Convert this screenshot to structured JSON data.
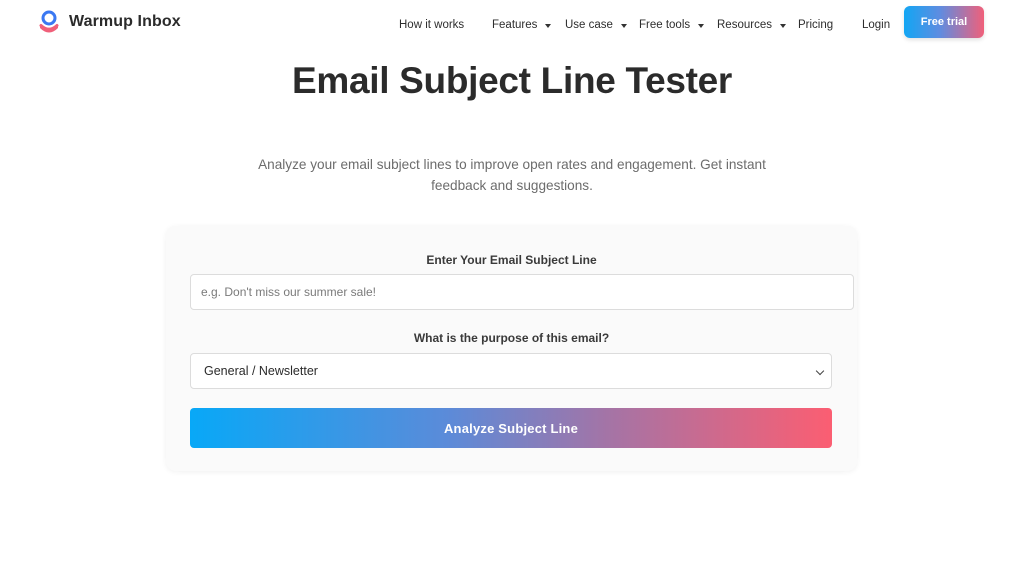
{
  "brand": {
    "name": "Warmup Inbox",
    "logo_icon": "warmup-inbox-logo-icon",
    "colors": {
      "ring": "#3a78f2",
      "base": "#f0607a"
    }
  },
  "nav": {
    "items": [
      {
        "label": "How it works",
        "dropdown": false
      },
      {
        "label": "Features",
        "dropdown": true
      },
      {
        "label": "Use case",
        "dropdown": true
      },
      {
        "label": "Free tools",
        "dropdown": true
      },
      {
        "label": "Resources",
        "dropdown": true
      },
      {
        "label": "Pricing",
        "dropdown": false
      },
      {
        "label": "Login",
        "dropdown": false
      }
    ],
    "cta_label": "Free trial"
  },
  "hero": {
    "title": "Email Subject Line Tester",
    "subtitle": "Analyze your email subject lines to improve open rates and engagement. Get instant feedback and suggestions."
  },
  "form": {
    "subject_label": "Enter Your Email Subject Line",
    "subject_placeholder": "e.g. Don't miss our summer sale!",
    "subject_value": "",
    "purpose_label": "What is the purpose of this email?",
    "purpose_selected": "General / Newsletter",
    "analyze_label": "Analyze Subject Line"
  },
  "colors": {
    "gradient_start": "#08a8f7",
    "gradient_end": "#fb5e72",
    "text_dark": "#2b2b2b",
    "text_muted": "#6c6c6c"
  }
}
